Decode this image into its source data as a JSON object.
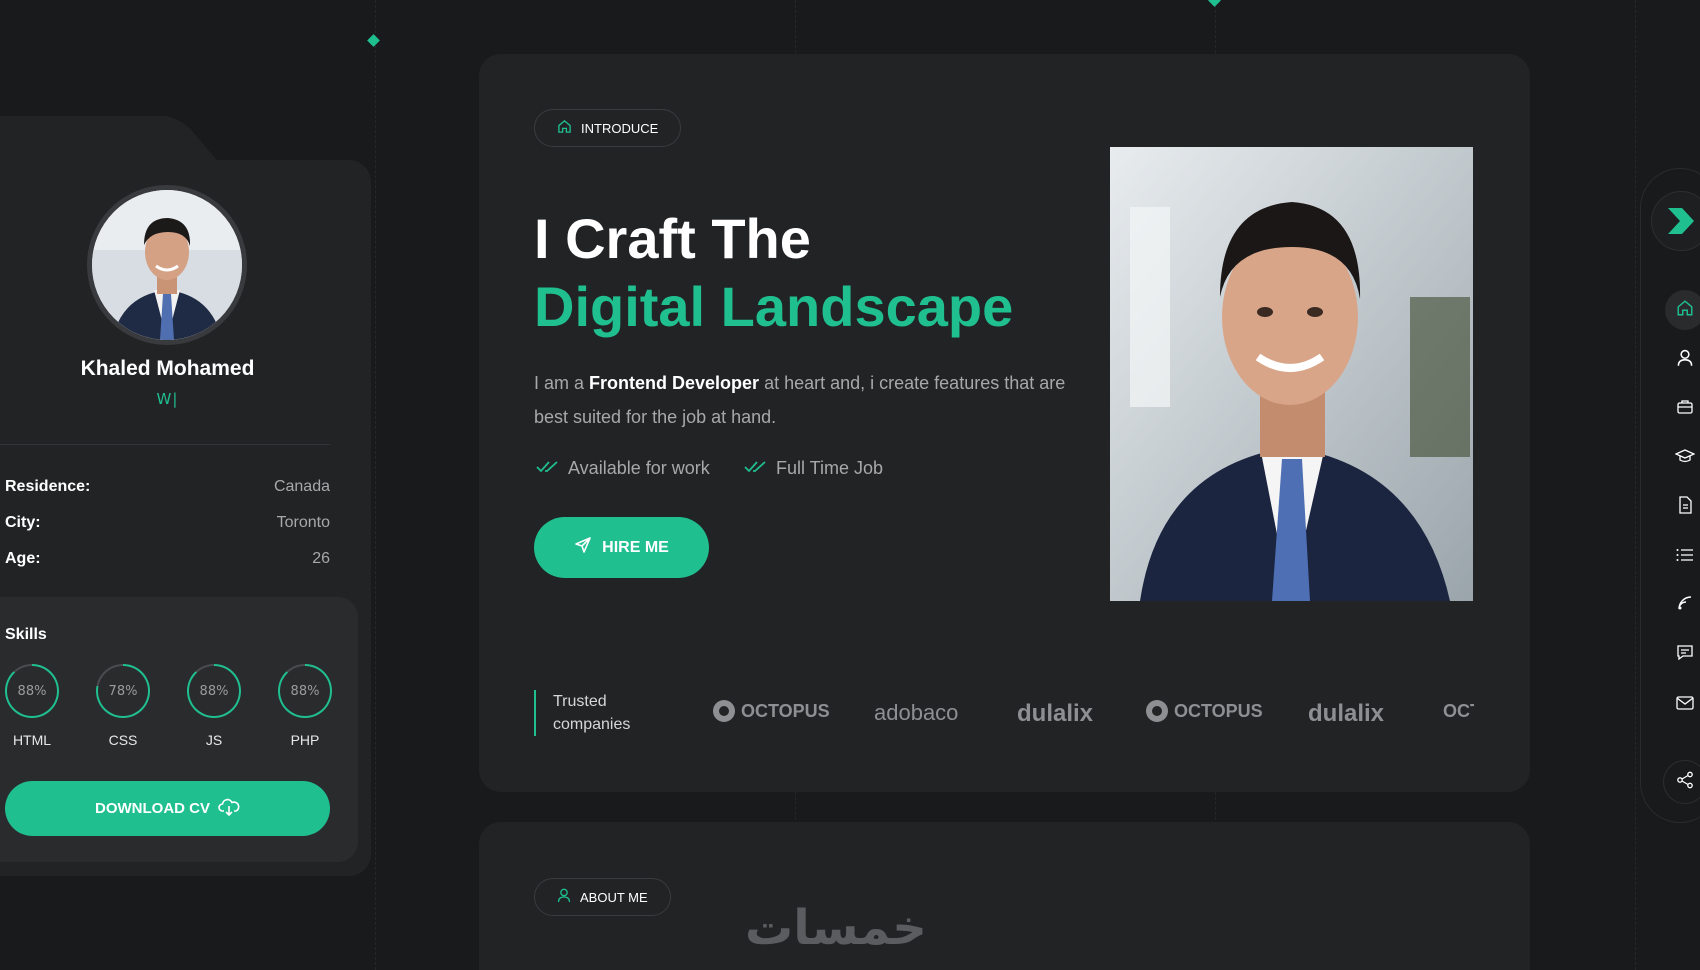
{
  "profile": {
    "name": "Khaled Mohamed",
    "role_typing": "W|",
    "info": [
      {
        "label": "Residence:",
        "value": "Canada"
      },
      {
        "label": "City:",
        "value": "Toronto"
      },
      {
        "label": "Age:",
        "value": "26"
      }
    ],
    "skills_title": "Skills",
    "skills": [
      {
        "name": "HTML",
        "percent_label": "88%",
        "percent": 88
      },
      {
        "name": "CSS",
        "percent_label": "78%",
        "percent": 78
      },
      {
        "name": "JS",
        "percent_label": "88%",
        "percent": 88
      },
      {
        "name": "PHP",
        "percent_label": "88%",
        "percent": 88
      }
    ],
    "download_label": "DOWNLOAD CV"
  },
  "hero": {
    "pill_label": "INTRODUCE",
    "title_line1": "I Craft The",
    "title_line2": "Digital Landscape",
    "desc_prefix": "I am a ",
    "desc_strong": "Frontend Developer",
    "desc_suffix": " at heart and, i create features that are best suited for the job at hand.",
    "checks": [
      "Available for work",
      "Full Time Job"
    ],
    "hire_label": "HIRE ME",
    "trusted_label": "Trusted companies",
    "logos": [
      "OCTOPUS",
      "adobaco",
      "dulalix",
      "OCTOPUS",
      "dulalix",
      "OCTOPUS"
    ]
  },
  "about": {
    "pill_label": "ABOUT ME"
  },
  "watermark": "خمسات",
  "nav": {
    "items": [
      "home-icon",
      "user-icon",
      "briefcase-icon",
      "graduation-cap-icon",
      "document-icon",
      "list-icon",
      "wifi-icon",
      "chat-icon",
      "mail-icon",
      "share-icon"
    ]
  },
  "colors": {
    "accent": "#1fbf8f",
    "background": "#191a1c",
    "card": "#222325"
  }
}
